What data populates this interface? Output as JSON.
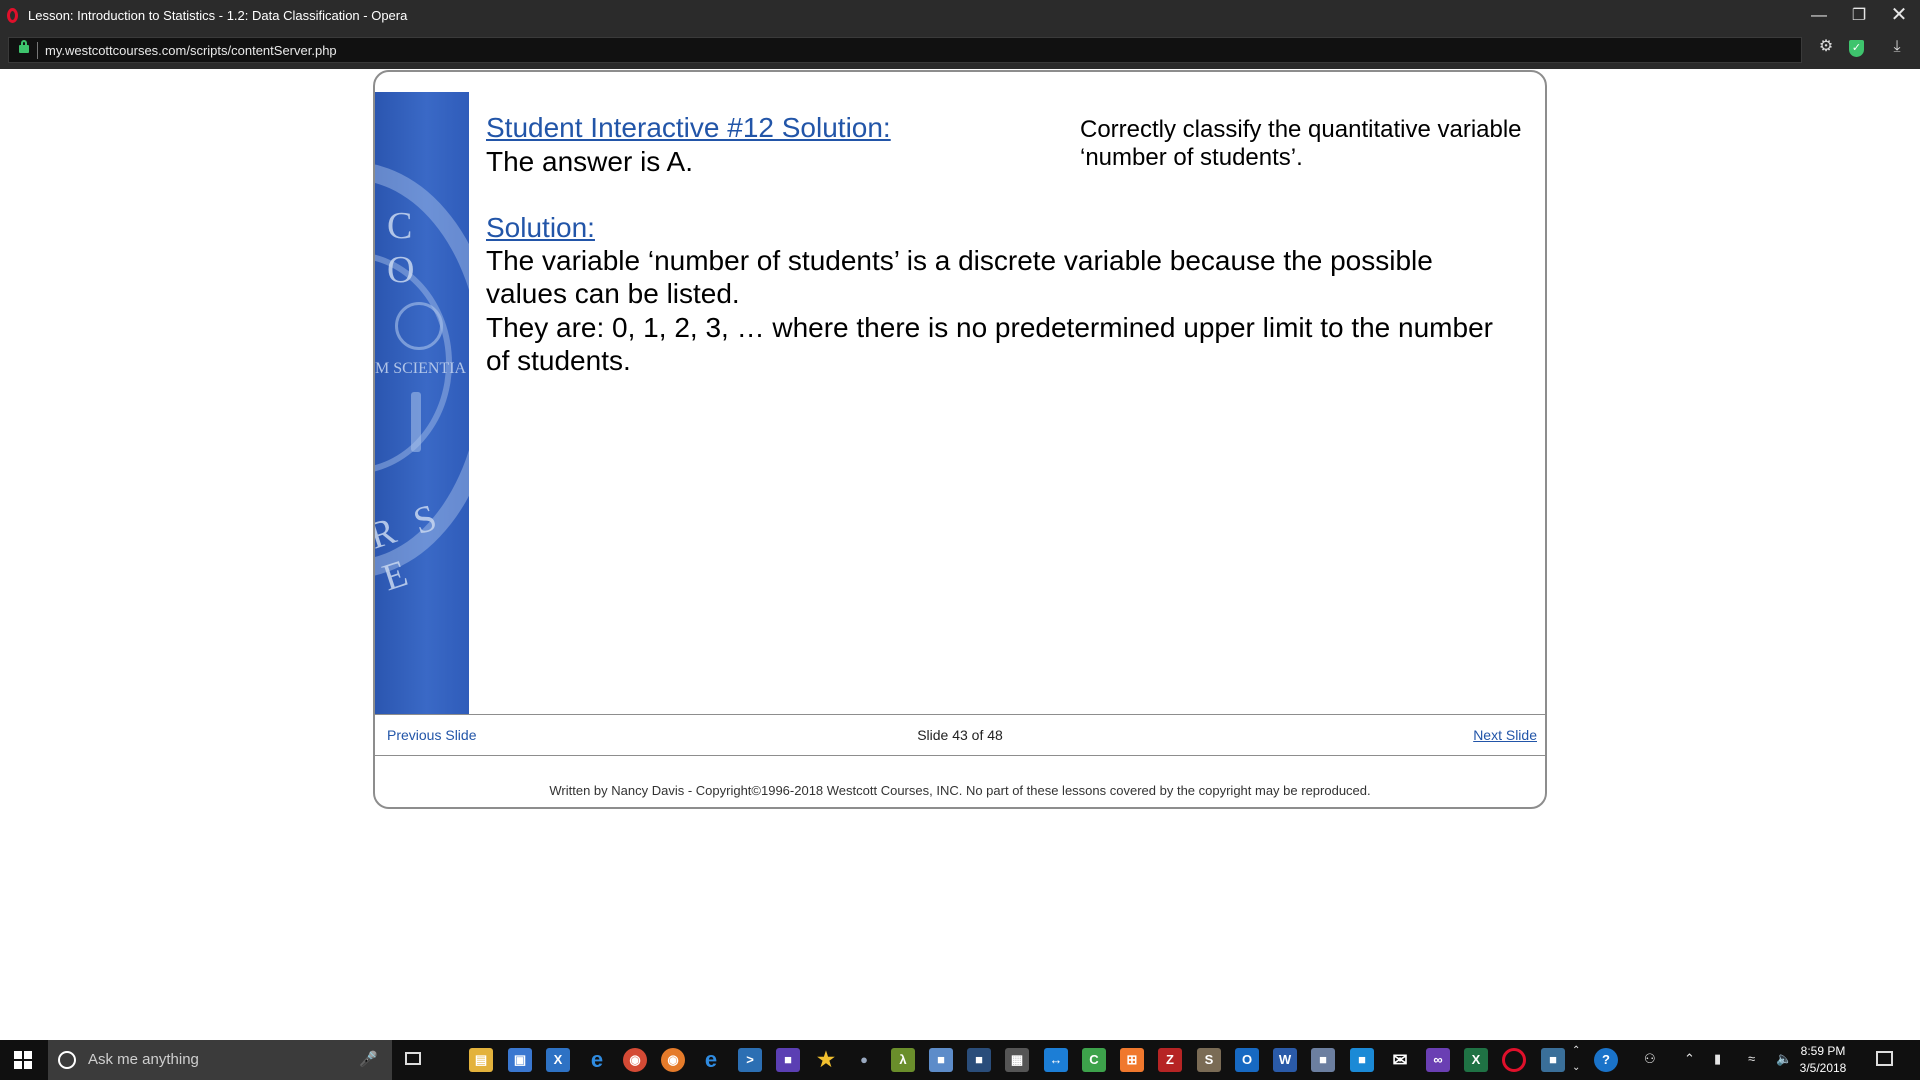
{
  "window": {
    "title": "Lesson: Introduction to Statistics - 1.2: Data Classification - Opera",
    "url": "my.westcottcourses.com/scripts/contentServer.php"
  },
  "seal": {
    "letters_top": "C O",
    "motto": "M SCIENTIA",
    "letters_bottom": "R S E"
  },
  "slide": {
    "heading": "Student Interactive #12 Solution:",
    "answer": "The answer is A.",
    "question_line1": "Correctly classify the quantitative variable",
    "question_line2": "‘number of students’.",
    "solution_heading": "Solution:",
    "solution_lines": [
      "The variable ‘number of students’ is a discrete variable because the possible",
      "values can be listed.",
      "They are:  0, 1, 2, 3, … where there is no predetermined upper limit to the number",
      "of students."
    ]
  },
  "navigation": {
    "previous": "Previous Slide",
    "counter": "Slide 43 of 48",
    "next": "Next Slide"
  },
  "footer": {
    "copyright": "Written by Nancy Davis - Copyright©1996-2018 Westcott Courses, INC. No part of these lessons covered by the copyright may be reproduced."
  },
  "taskbar": {
    "search_placeholder": "Ask me anything",
    "time": "8:59 PM",
    "date": "3/5/2018"
  }
}
